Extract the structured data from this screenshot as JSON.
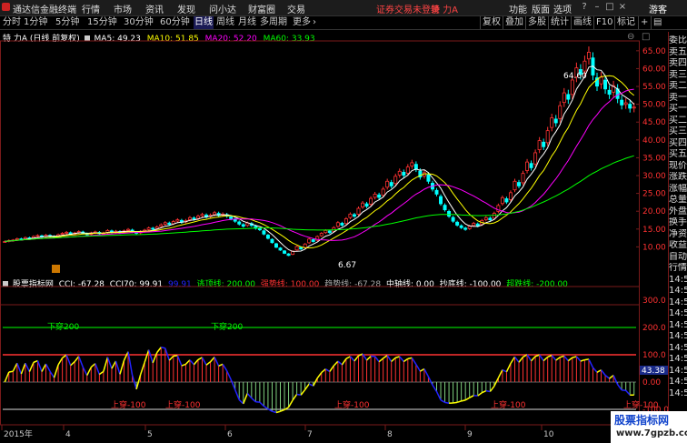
{
  "titlebar": {
    "app_name": "通达信金融终端",
    "menus": [
      "行情",
      "市场",
      "资讯",
      "发现",
      "问小达",
      "财富圈",
      "交易"
    ],
    "login_status": "证券交易未登录",
    "stock": "特 力A",
    "right_menus": [
      "功能",
      "版面",
      "选项"
    ],
    "guest": "游客"
  },
  "periods": [
    "分时",
    "1分钟",
    "5分钟",
    "15分钟",
    "30分钟",
    "60分钟",
    "日线",
    "周线",
    "月线",
    "多周期",
    "更多"
  ],
  "active_period": "日线",
  "right_buttons": [
    "复权",
    "叠加",
    "多股",
    "统计",
    "画线",
    "F10",
    "标记"
  ],
  "main_header": {
    "name": "特 力A",
    "desc": "(日线 前复权)",
    "ma5": "MA5: 49.23",
    "ma10": "MA10: 51.85",
    "ma20": "MA20: 52.20",
    "ma60": "MA60: 33.93"
  },
  "colors": {
    "up": "#ff3232",
    "down": "#00ffff",
    "ma5": "#ffffff",
    "ma10": "#ffff00",
    "ma20": "#ff00ff",
    "ma60": "#00ff00",
    "cci": "#ffff00",
    "cci2": "#2222ff"
  },
  "price_axis": [
    "65.00",
    "60.00",
    "55.00",
    "50.00",
    "45.00",
    "40.00",
    "35.00",
    "30.00",
    "25.00",
    "20.00",
    "15.00",
    "10.00"
  ],
  "price_labels": {
    "high": "64.60",
    "low": "6.67"
  },
  "indicator_header": {
    "name": "股票指标网",
    "cci": "CCI: -67.28",
    "cci70": "CCI70: 99.91",
    "v1": "99.91",
    "top": "逃顶线: 200.00",
    "strong": "强势线: 100.00",
    "trend": "趋势线: -67.28",
    "mid": "中轴线: 0.00",
    "bottom": "抄底线: -100.00",
    "weak": "超跌线: -200.00"
  },
  "indicator_axis": [
    "300.0",
    "200.0",
    "100.0",
    "0.00",
    "-100.0"
  ],
  "indicator_current": "43.38",
  "signals": [
    "下穿200",
    "下穿200",
    "上穿-100",
    "上穿-100",
    "上穿-100",
    "上穿-100",
    "上穿-100"
  ],
  "date_axis": [
    "2015年",
    "4",
    "5",
    "6",
    "7",
    "8",
    "9",
    "10"
  ],
  "right_panel": [
    "委比",
    "卖五",
    "卖四",
    "卖三",
    "卖二",
    "卖一",
    "买一",
    "买二",
    "买三",
    "买四",
    "买五",
    "现价",
    "涨跌",
    "涨幅",
    "总量",
    "外盘",
    "换手",
    "净资",
    "收益",
    "自动",
    "行情",
    "14:50",
    "14:50",
    "14:50",
    "14:50",
    "14:50",
    "14:50",
    "14:50",
    "14:50",
    "14:50",
    "14:50",
    "14:5"
  ],
  "watermark": {
    "line1": "股票指标网",
    "line2": "www.7gpzb.com"
  },
  "chart_data": {
    "type": "candlestick",
    "x": "trading days 2015-03 to 2015-11",
    "close": [
      11.5,
      11.8,
      11.9,
      12.3,
      12.1,
      12.6,
      12.4,
      12.9,
      13.2,
      12.8,
      13.3,
      13.0,
      12.7,
      13.4,
      13.8,
      14.1,
      13.6,
      13.9,
      14.3,
      13.8,
      13.4,
      13.9,
      14.2,
      13.7,
      13.9,
      14.6,
      14.1,
      14.4,
      14.0,
      14.5,
      14.9,
      14.2,
      13.8,
      14.3,
      14.7,
      15.3,
      15.0,
      15.6,
      16.2,
      16.8,
      16.3,
      17.1,
      17.6,
      16.9,
      17.4,
      18.2,
      17.8,
      18.6,
      19.1,
      18.4,
      18.9,
      19.6,
      18.8,
      19.2,
      18.6,
      17.9,
      17.2,
      16.4,
      15.8,
      16.7,
      16.0,
      15.2,
      14.8,
      13.6,
      12.4,
      11.2,
      9.9,
      9.1,
      8.2,
      7.6,
      8.8,
      10.1,
      9.4,
      10.8,
      12.2,
      11.5,
      12.9,
      13.8,
      14.6,
      14.0,
      15.4,
      16.8,
      16.1,
      17.9,
      19.2,
      18.6,
      20.8,
      22.3,
      21.4,
      23.6,
      24.8,
      23.9,
      26.2,
      28.4,
      27.1,
      29.8,
      31.2,
      30.1,
      32.4,
      33.6,
      31.8,
      29.6,
      30.8,
      28.4,
      26.2,
      24.8,
      22.1,
      20.4,
      18.6,
      17.2,
      16.1,
      15.4,
      14.9,
      15.8,
      16.6,
      15.9,
      17.4,
      18.2,
      17.6,
      19.4,
      21.6,
      23.8,
      22.6,
      25.2,
      28.4,
      27.1,
      30.6,
      33.8,
      32.2,
      36.4,
      39.8,
      38.1,
      42.6,
      46.2,
      44.8,
      49.6,
      53.2,
      51.4,
      56.8,
      60.2,
      58.4,
      62.1,
      64.6,
      58.2,
      55.1,
      57.6,
      54.3,
      52.8,
      55.2,
      51.6,
      49.8,
      50.4,
      48.9,
      49.2
    ],
    "ma60_end": 33.93,
    "ylim": [
      5,
      67
    ],
    "indicator": {
      "name": "CCI",
      "current": -67.28,
      "levels": [
        200,
        100,
        0,
        -100,
        -200
      ],
      "ylim": [
        -150,
        330
      ]
    }
  }
}
